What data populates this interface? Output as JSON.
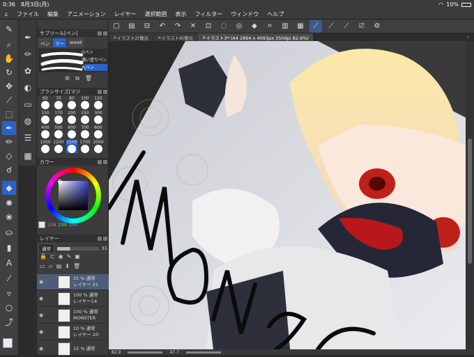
{
  "status": {
    "time": "0:36",
    "date": "8月3日(月)",
    "battery": "10%"
  },
  "menu": [
    "ファイル",
    "編集",
    "アニメーション",
    "レイヤー",
    "選択範囲",
    "表示",
    "フィルター",
    "ウィンドウ",
    "ヘルプ"
  ],
  "tabs": [
    "イラスト2(復元",
    "イラスト6(復元",
    "イラスト3* (A4 2894 x 4093px 350dpi 82.9%)"
  ],
  "subtool": {
    "title": "サブツール[ペン]",
    "tabs": [
      "ペン",
      "マー",
      "wood"
    ],
    "items": [
      "Gペン",
      "濃い塗りペン",
      "丸ペン"
    ]
  },
  "brushsize": {
    "title": "ブラシサイズ[マジ",
    "sizes": [
      "60",
      "70",
      "80",
      "100",
      "120",
      "150",
      "170",
      "200",
      "250",
      "300",
      "400",
      "500",
      "600",
      "700",
      "800",
      "1000",
      "1200",
      "1500",
      "1700",
      "2000"
    ]
  },
  "color": {
    "title": "カラー",
    "r": "228",
    "g": "230",
    "b": "244"
  },
  "layers": {
    "title": "レイヤー",
    "blend": "通常",
    "opacity": "31",
    "rows": [
      {
        "pct": "31 % 通常",
        "name": "レイヤー 21"
      },
      {
        "pct": "100 % 通常",
        "name": "レイヤー14"
      },
      {
        "pct": "100 % 通常",
        "name": "MONSTER"
      },
      {
        "pct": "10 % 通常",
        "name": "レイヤー 20"
      },
      {
        "pct": "15 % 通常",
        "name": ""
      }
    ]
  },
  "bottom": {
    "zoom": "82.9",
    "angle": "47.7"
  },
  "colors": {
    "accent": "#2a63c8",
    "selected_layer": "#4e5d77"
  }
}
